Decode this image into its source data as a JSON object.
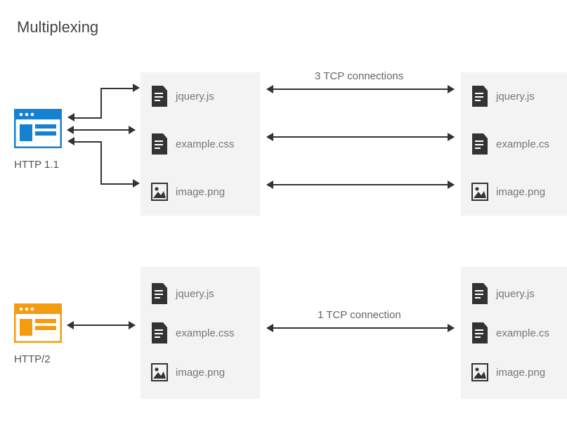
{
  "title": "Multiplexing",
  "http1": {
    "label": "HTTP 1.1",
    "conn_label": "3 TCP connections",
    "files_left": [
      "jquery.js",
      "example.css",
      "image.png"
    ],
    "files_right": [
      "jquery.js",
      "example.cs",
      "image.png"
    ]
  },
  "http2": {
    "label": "HTTP/2",
    "conn_label": "1 TCP connection",
    "files_left": [
      "jquery.js",
      "example.css",
      "image.png"
    ],
    "files_right": [
      "jquery.js",
      "example.cs",
      "image.png"
    ]
  }
}
